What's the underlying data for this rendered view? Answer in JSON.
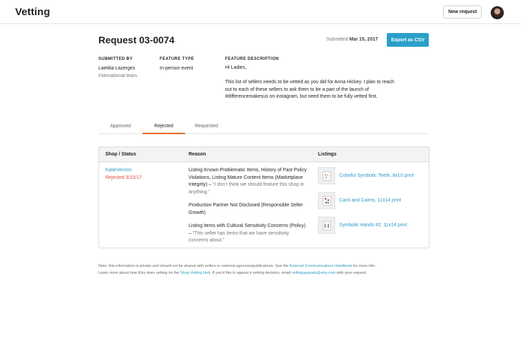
{
  "header": {
    "app_title": "Vetting",
    "new_request_label": "New request"
  },
  "request": {
    "title": "Request 03-0074",
    "submitted_prefix": "Submitted",
    "submitted_date": "Mar 15, 2017",
    "export_label": "Export as CSV"
  },
  "meta": {
    "submitted_by_label": "SUBMITTED BY",
    "submitted_by_name": "Laetitia Lazerges",
    "submitted_by_team": "International team",
    "feature_type_label": "FEATURE TYPE",
    "feature_type_value": "In-person event",
    "feature_description_label": "FEATURE DESCRIPTION",
    "description_greeting": "Hi Ladies,",
    "description_body": "This list of sellers needs to be vetted as you did for Anna Hickey. I plan to reach out to each of these sellers to ask them to be a part of the launch of #differencemakesus on instagram, but need them to be fully vetted first."
  },
  "tabs": [
    {
      "label": "Approved",
      "active": false
    },
    {
      "label": "Rejected",
      "active": true
    },
    {
      "label": "Requested",
      "active": false
    }
  ],
  "table": {
    "headers": {
      "shop_status": "Shop / Status",
      "reason": "Reason",
      "listings": "Listings"
    },
    "row": {
      "shop_name": "KatieVernon",
      "status": "Rejected 3/15/17",
      "reasons": [
        {
          "text": "Listing Known Problematic Items, History of Past Policy Violations, Listing Mature Content Items (Marketplace Integrity) – ",
          "quote": "“I don’t think we should feature this shop in anything.”"
        },
        {
          "text": "Production Partner Not Disclosed (Responsible Seller Growth)",
          "quote": ""
        },
        {
          "text": "Listing items with Cultural Sensitivity Concerns (Policy) – ",
          "quote": "“This seller has items that we have sensitivity concerns about.”"
        }
      ],
      "listings": [
        {
          "title": "Colorful Symbolic Teeth, 8x10 print",
          "icon": "print-thumbnail"
        },
        {
          "title": "Cacti and Cairns, 11x14 print",
          "icon": "print-thumbnail"
        },
        {
          "title": "Symbolic Hands #2, 11x14 print",
          "icon": "print-thumbnail"
        }
      ]
    }
  },
  "footnote": {
    "line1_a": "Note: this information is private and should not be shared with sellers or external agencies/publications. See the ",
    "line1_link": "External Communications Handbook",
    "line1_b": " for more info.",
    "line2_a": "Learn more about how Etsy does vetting on the ",
    "line2_link": "Shop Vetting Hub",
    "line2_b": ". If you’d like to appeal a vetting decision, email ",
    "line2_email": "vettingappeals@etsy.com",
    "line2_c": " with your request."
  },
  "colors": {
    "accent_blue": "#2aa0c9",
    "link_blue": "#2a9ac4",
    "rejected_red": "#e04b3f",
    "active_tab_orange": "#e8662a"
  }
}
